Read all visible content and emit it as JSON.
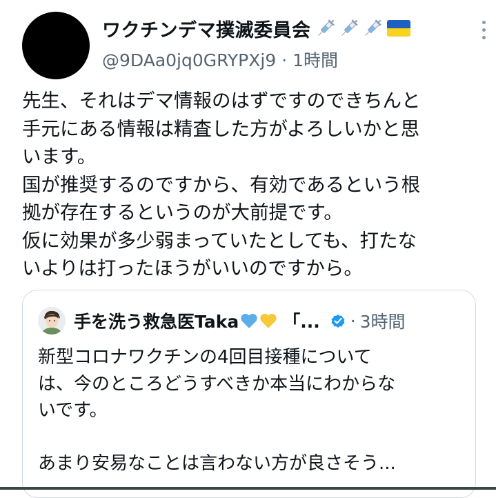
{
  "author": {
    "display_name": "ワクチンデマ撲滅委員会",
    "handle": "@9DAa0jq0GRYPXj9",
    "separator": "·",
    "time": "1時間",
    "badges": [
      "syringe-icon",
      "syringe-icon",
      "syringe-icon",
      "ukraine-flag-icon"
    ]
  },
  "tweet": {
    "text": "先生、それはデマ情報のはずですのできちんと\n手元にある情報は精査した方がよろしいかと思\nいます。\n国が推奨するのですから、有効であるという根\n拠が存在するというのが大前提です。\n仮に効果が多少弱まっていたとしても、打たな\nいよりは打ったほうがいいのですから。"
  },
  "quote": {
    "display_name": "手を洗う救急医Taka",
    "name_suffix": "「...",
    "separator": "·",
    "time": "3時間",
    "text": "新型コロナワクチンの4回目接種について\nは、今のところどうすべきか本当にわからな\nいです。\n\nあまり安易なことは言わない方が良さそう..."
  },
  "colors": {
    "text": "#0f1419",
    "secondary": "#536471",
    "border": "#cfd9de",
    "verified": "#1d9bf0",
    "blue_heart": "#5aaeea",
    "yellow_heart": "#f7c93a"
  }
}
